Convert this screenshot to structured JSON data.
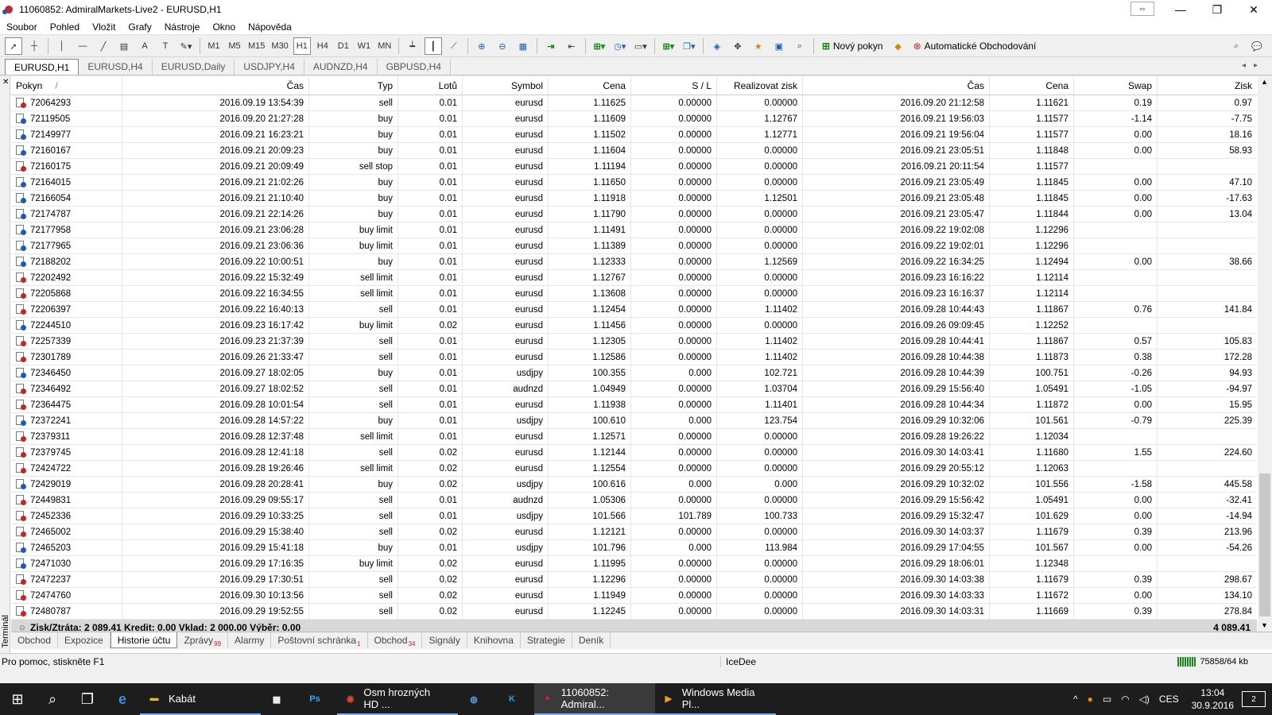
{
  "window": {
    "title": "11060852: AdmiralMarkets-Live2 - EURUSD,H1"
  },
  "menu": [
    "Soubor",
    "Pohled",
    "Vložit",
    "Grafy",
    "Nástroje",
    "Okno",
    "Nápověda"
  ],
  "toolbar": {
    "timeframes": [
      "M1",
      "M5",
      "M15",
      "M30",
      "H1",
      "H4",
      "D1",
      "W1",
      "MN"
    ],
    "active_timeframe": "H1",
    "new_order_label": "Nový pokyn",
    "autotrading_label": "Automatické Obchodování"
  },
  "chart_tabs": [
    "EURUSD,H1",
    "EURUSD,H4",
    "EURUSD,Daily",
    "USDJPY,H4",
    "AUDNZD,H4",
    "GBPUSD,H4"
  ],
  "terminal": {
    "side_label": "Terminál",
    "columns": [
      "Pokyn",
      "Čas",
      "Typ",
      "Lotů",
      "Symbol",
      "Cena",
      "S / L",
      "Realizovat zisk",
      "Čas",
      "Cena",
      "Swap",
      "Zisk"
    ],
    "sort_indicator": "/",
    "rows": [
      {
        "id": "72064293",
        "open": "2016.09.19 13:54:39",
        "type": "sell",
        "lots": "0.01",
        "symbol": "eurusd",
        "price": "1.11625",
        "sl": "0.00000",
        "tp": "0.00000",
        "close": "2016.09.20 21:12:58",
        "cprice": "1.11621",
        "swap": "0.19",
        "profit": "0.97"
      },
      {
        "id": "72119505",
        "open": "2016.09.20 21:27:28",
        "type": "buy",
        "lots": "0.01",
        "symbol": "eurusd",
        "price": "1.11609",
        "sl": "0.00000",
        "tp": "1.12767",
        "close": "2016.09.21 19:56:03",
        "cprice": "1.11577",
        "swap": "-1.14",
        "profit": "-7.75"
      },
      {
        "id": "72149977",
        "open": "2016.09.21 16:23:21",
        "type": "buy",
        "lots": "0.01",
        "symbol": "eurusd",
        "price": "1.11502",
        "sl": "0.00000",
        "tp": "1.12771",
        "close": "2016.09.21 19:56:04",
        "cprice": "1.11577",
        "swap": "0.00",
        "profit": "18.16"
      },
      {
        "id": "72160167",
        "open": "2016.09.21 20:09:23",
        "type": "buy",
        "lots": "0.01",
        "symbol": "eurusd",
        "price": "1.11604",
        "sl": "0.00000",
        "tp": "0.00000",
        "close": "2016.09.21 23:05:51",
        "cprice": "1.11848",
        "swap": "0.00",
        "profit": "58.93"
      },
      {
        "id": "72160175",
        "open": "2016.09.21 20:09:49",
        "type": "sell stop",
        "lots": "0.01",
        "symbol": "eurusd",
        "price": "1.11194",
        "sl": "0.00000",
        "tp": "0.00000",
        "close": "2016.09.21 20:11:54",
        "cprice": "1.11577",
        "swap": "",
        "profit": ""
      },
      {
        "id": "72164015",
        "open": "2016.09.21 21:02:26",
        "type": "buy",
        "lots": "0.01",
        "symbol": "eurusd",
        "price": "1.11650",
        "sl": "0.00000",
        "tp": "0.00000",
        "close": "2016.09.21 23:05:49",
        "cprice": "1.11845",
        "swap": "0.00",
        "profit": "47.10"
      },
      {
        "id": "72166054",
        "open": "2016.09.21 21:10:40",
        "type": "buy",
        "lots": "0.01",
        "symbol": "eurusd",
        "price": "1.11918",
        "sl": "0.00000",
        "tp": "1.12501",
        "close": "2016.09.21 23:05:48",
        "cprice": "1.11845",
        "swap": "0.00",
        "profit": "-17.63"
      },
      {
        "id": "72174787",
        "open": "2016.09.21 22:14:26",
        "type": "buy",
        "lots": "0.01",
        "symbol": "eurusd",
        "price": "1.11790",
        "sl": "0.00000",
        "tp": "0.00000",
        "close": "2016.09.21 23:05:47",
        "cprice": "1.11844",
        "swap": "0.00",
        "profit": "13.04"
      },
      {
        "id": "72177958",
        "open": "2016.09.21 23:06:28",
        "type": "buy limit",
        "lots": "0.01",
        "symbol": "eurusd",
        "price": "1.11491",
        "sl": "0.00000",
        "tp": "0.00000",
        "close": "2016.09.22 19:02:08",
        "cprice": "1.12296",
        "swap": "",
        "profit": ""
      },
      {
        "id": "72177965",
        "open": "2016.09.21 23:06:36",
        "type": "buy limit",
        "lots": "0.01",
        "symbol": "eurusd",
        "price": "1.11389",
        "sl": "0.00000",
        "tp": "0.00000",
        "close": "2016.09.22 19:02:01",
        "cprice": "1.12296",
        "swap": "",
        "profit": ""
      },
      {
        "id": "72188202",
        "open": "2016.09.22 10:00:51",
        "type": "buy",
        "lots": "0.01",
        "symbol": "eurusd",
        "price": "1.12333",
        "sl": "0.00000",
        "tp": "1.12569",
        "close": "2016.09.22 16:34:25",
        "cprice": "1.12494",
        "swap": "0.00",
        "profit": "38.66"
      },
      {
        "id": "72202492",
        "open": "2016.09.22 15:32:49",
        "type": "sell limit",
        "lots": "0.01",
        "symbol": "eurusd",
        "price": "1.12767",
        "sl": "0.00000",
        "tp": "0.00000",
        "close": "2016.09.23 16:16:22",
        "cprice": "1.12114",
        "swap": "",
        "profit": ""
      },
      {
        "id": "72205868",
        "open": "2016.09.22 16:34:55",
        "type": "sell limit",
        "lots": "0.01",
        "symbol": "eurusd",
        "price": "1.13608",
        "sl": "0.00000",
        "tp": "0.00000",
        "close": "2016.09.23 16:16:37",
        "cprice": "1.12114",
        "swap": "",
        "profit": ""
      },
      {
        "id": "72206397",
        "open": "2016.09.22 16:40:13",
        "type": "sell",
        "lots": "0.01",
        "symbol": "eurusd",
        "price": "1.12454",
        "sl": "0.00000",
        "tp": "1.11402",
        "close": "2016.09.28 10:44:43",
        "cprice": "1.11867",
        "swap": "0.76",
        "profit": "141.84"
      },
      {
        "id": "72244510",
        "open": "2016.09.23 16:17:42",
        "type": "buy limit",
        "lots": "0.02",
        "symbol": "eurusd",
        "price": "1.11456",
        "sl": "0.00000",
        "tp": "0.00000",
        "close": "2016.09.26 09:09:45",
        "cprice": "1.12252",
        "swap": "",
        "profit": ""
      },
      {
        "id": "72257339",
        "open": "2016.09.23 21:37:39",
        "type": "sell",
        "lots": "0.01",
        "symbol": "eurusd",
        "price": "1.12305",
        "sl": "0.00000",
        "tp": "1.11402",
        "close": "2016.09.28 10:44:41",
        "cprice": "1.11867",
        "swap": "0.57",
        "profit": "105.83"
      },
      {
        "id": "72301789",
        "open": "2016.09.26 21:33:47",
        "type": "sell",
        "lots": "0.01",
        "symbol": "eurusd",
        "price": "1.12586",
        "sl": "0.00000",
        "tp": "1.11402",
        "close": "2016.09.28 10:44:38",
        "cprice": "1.11873",
        "swap": "0.38",
        "profit": "172.28"
      },
      {
        "id": "72346450",
        "open": "2016.09.27 18:02:05",
        "type": "buy",
        "lots": "0.01",
        "symbol": "usdjpy",
        "price": "100.355",
        "sl": "0.000",
        "tp": "102.721",
        "close": "2016.09.28 10:44:39",
        "cprice": "100.751",
        "swap": "-0.26",
        "profit": "94.93"
      },
      {
        "id": "72346492",
        "open": "2016.09.27 18:02:52",
        "type": "sell",
        "lots": "0.01",
        "symbol": "audnzd",
        "price": "1.04949",
        "sl": "0.00000",
        "tp": "1.03704",
        "close": "2016.09.29 15:56:40",
        "cprice": "1.05491",
        "swap": "-1.05",
        "profit": "-94.97"
      },
      {
        "id": "72364475",
        "open": "2016.09.28 10:01:54",
        "type": "sell",
        "lots": "0.01",
        "symbol": "eurusd",
        "price": "1.11938",
        "sl": "0.00000",
        "tp": "1.11401",
        "close": "2016.09.28 10:44:34",
        "cprice": "1.11872",
        "swap": "0.00",
        "profit": "15.95"
      },
      {
        "id": "72372241",
        "open": "2016.09.28 14:57:22",
        "type": "buy",
        "lots": "0.01",
        "symbol": "usdjpy",
        "price": "100.610",
        "sl": "0.000",
        "tp": "123.754",
        "close": "2016.09.29 10:32:06",
        "cprice": "101.561",
        "swap": "-0.79",
        "profit": "225.39"
      },
      {
        "id": "72379311",
        "open": "2016.09.28 12:37:48",
        "type": "sell limit",
        "lots": "0.01",
        "symbol": "eurusd",
        "price": "1.12571",
        "sl": "0.00000",
        "tp": "0.00000",
        "close": "2016.09.28 19:26:22",
        "cprice": "1.12034",
        "swap": "",
        "profit": ""
      },
      {
        "id": "72379745",
        "open": "2016.09.28 12:41:18",
        "type": "sell",
        "lots": "0.02",
        "symbol": "eurusd",
        "price": "1.12144",
        "sl": "0.00000",
        "tp": "0.00000",
        "close": "2016.09.30 14:03:41",
        "cprice": "1.11680",
        "swap": "1.55",
        "profit": "224.60"
      },
      {
        "id": "72424722",
        "open": "2016.09.28 19:26:46",
        "type": "sell limit",
        "lots": "0.02",
        "symbol": "eurusd",
        "price": "1.12554",
        "sl": "0.00000",
        "tp": "0.00000",
        "close": "2016.09.29 20:55:12",
        "cprice": "1.12063",
        "swap": "",
        "profit": ""
      },
      {
        "id": "72429019",
        "open": "2016.09.28 20:28:41",
        "type": "buy",
        "lots": "0.02",
        "symbol": "usdjpy",
        "price": "100.616",
        "sl": "0.000",
        "tp": "0.000",
        "close": "2016.09.29 10:32:02",
        "cprice": "101.556",
        "swap": "-1.58",
        "profit": "445.58"
      },
      {
        "id": "72449831",
        "open": "2016.09.29 09:55:17",
        "type": "sell",
        "lots": "0.01",
        "symbol": "audnzd",
        "price": "1.05306",
        "sl": "0.00000",
        "tp": "0.00000",
        "close": "2016.09.29 15:56:42",
        "cprice": "1.05491",
        "swap": "0.00",
        "profit": "-32.41"
      },
      {
        "id": "72452336",
        "open": "2016.09.29 10:33:25",
        "type": "sell",
        "lots": "0.01",
        "symbol": "usdjpy",
        "price": "101.566",
        "sl": "101.789",
        "tp": "100.733",
        "close": "2016.09.29 15:32:47",
        "cprice": "101.629",
        "swap": "0.00",
        "profit": "-14.94"
      },
      {
        "id": "72465002",
        "open": "2016.09.29 15:38:40",
        "type": "sell",
        "lots": "0.02",
        "symbol": "eurusd",
        "price": "1.12121",
        "sl": "0.00000",
        "tp": "0.00000",
        "close": "2016.09.30 14:03:37",
        "cprice": "1.11679",
        "swap": "0.39",
        "profit": "213.96"
      },
      {
        "id": "72465203",
        "open": "2016.09.29 15:41:18",
        "type": "buy",
        "lots": "0.01",
        "symbol": "usdjpy",
        "price": "101.796",
        "sl": "0.000",
        "tp": "113.984",
        "close": "2016.09.29 17:04:55",
        "cprice": "101.567",
        "swap": "0.00",
        "profit": "-54.26"
      },
      {
        "id": "72471030",
        "open": "2016.09.29 17:16:35",
        "type": "buy limit",
        "lots": "0.02",
        "symbol": "eurusd",
        "price": "1.11995",
        "sl": "0.00000",
        "tp": "0.00000",
        "close": "2016.09.29 18:06:01",
        "cprice": "1.12348",
        "swap": "",
        "profit": ""
      },
      {
        "id": "72472237",
        "open": "2016.09.29 17:30:51",
        "type": "sell",
        "lots": "0.02",
        "symbol": "eurusd",
        "price": "1.12296",
        "sl": "0.00000",
        "tp": "0.00000",
        "close": "2016.09.30 14:03:38",
        "cprice": "1.11679",
        "swap": "0.39",
        "profit": "298.67"
      },
      {
        "id": "72474760",
        "open": "2016.09.30 10:13:56",
        "type": "sell",
        "lots": "0.02",
        "symbol": "eurusd",
        "price": "1.11949",
        "sl": "0.00000",
        "tp": "0.00000",
        "close": "2016.09.30 14:03:33",
        "cprice": "1.11672",
        "swap": "0.00",
        "profit": "134.10"
      },
      {
        "id": "72480787",
        "open": "2016.09.29 19:52:55",
        "type": "sell",
        "lots": "0.02",
        "symbol": "eurusd",
        "price": "1.12245",
        "sl": "0.00000",
        "tp": "0.00000",
        "close": "2016.09.30 14:03:31",
        "cprice": "1.11669",
        "swap": "0.39",
        "profit": "278.84"
      }
    ],
    "summary": {
      "text": "Zisk/Ztráta: 2 089.41  Kredit: 0.00  Vklad: 2 000.00  Výběr: 0.00",
      "total": "4 089.41"
    },
    "tabs": [
      {
        "label": "Obchod",
        "badge": ""
      },
      {
        "label": "Expozice",
        "badge": ""
      },
      {
        "label": "Historie účtu",
        "badge": ""
      },
      {
        "label": "Zprávy",
        "badge": "99"
      },
      {
        "label": "Alarmy",
        "badge": ""
      },
      {
        "label": "Poštovní schránka",
        "badge": "1"
      },
      {
        "label": "Obchod",
        "badge": "34"
      },
      {
        "label": "Signály",
        "badge": ""
      },
      {
        "label": "Knihovna",
        "badge": ""
      },
      {
        "label": "Strategie",
        "badge": ""
      },
      {
        "label": "Deník",
        "badge": ""
      }
    ],
    "active_tab_index": 2
  },
  "status": {
    "help": "Pro pomoc, stiskněte F1",
    "profile": "IceDee",
    "connection": "75858/64 kb"
  },
  "taskbar": {
    "items": [
      {
        "label": "Kabát",
        "icon": "folder-icon",
        "color": "#e8b820"
      },
      {
        "label": "",
        "icon": "store-icon",
        "color": "#ffffff"
      },
      {
        "label": "",
        "icon": "photoshop-icon",
        "color": "#31a8ff"
      },
      {
        "label": "Osm hrozných HD ...",
        "icon": "chrome-icon",
        "color": "#db4437"
      },
      {
        "label": "",
        "icon": "vpn-icon",
        "color": "#5b9bd5"
      },
      {
        "label": "",
        "icon": "kbs-icon",
        "color": "#2aa0d0"
      },
      {
        "label": "11060852: Admiral...",
        "icon": "metatrader-icon",
        "color": "#d0202a"
      },
      {
        "label": "Windows Media Pl...",
        "icon": "media-player-icon",
        "color": "#f0a020"
      }
    ],
    "language": "CES",
    "time": "13:04",
    "date": "30.9.2016",
    "notifications": "2"
  }
}
